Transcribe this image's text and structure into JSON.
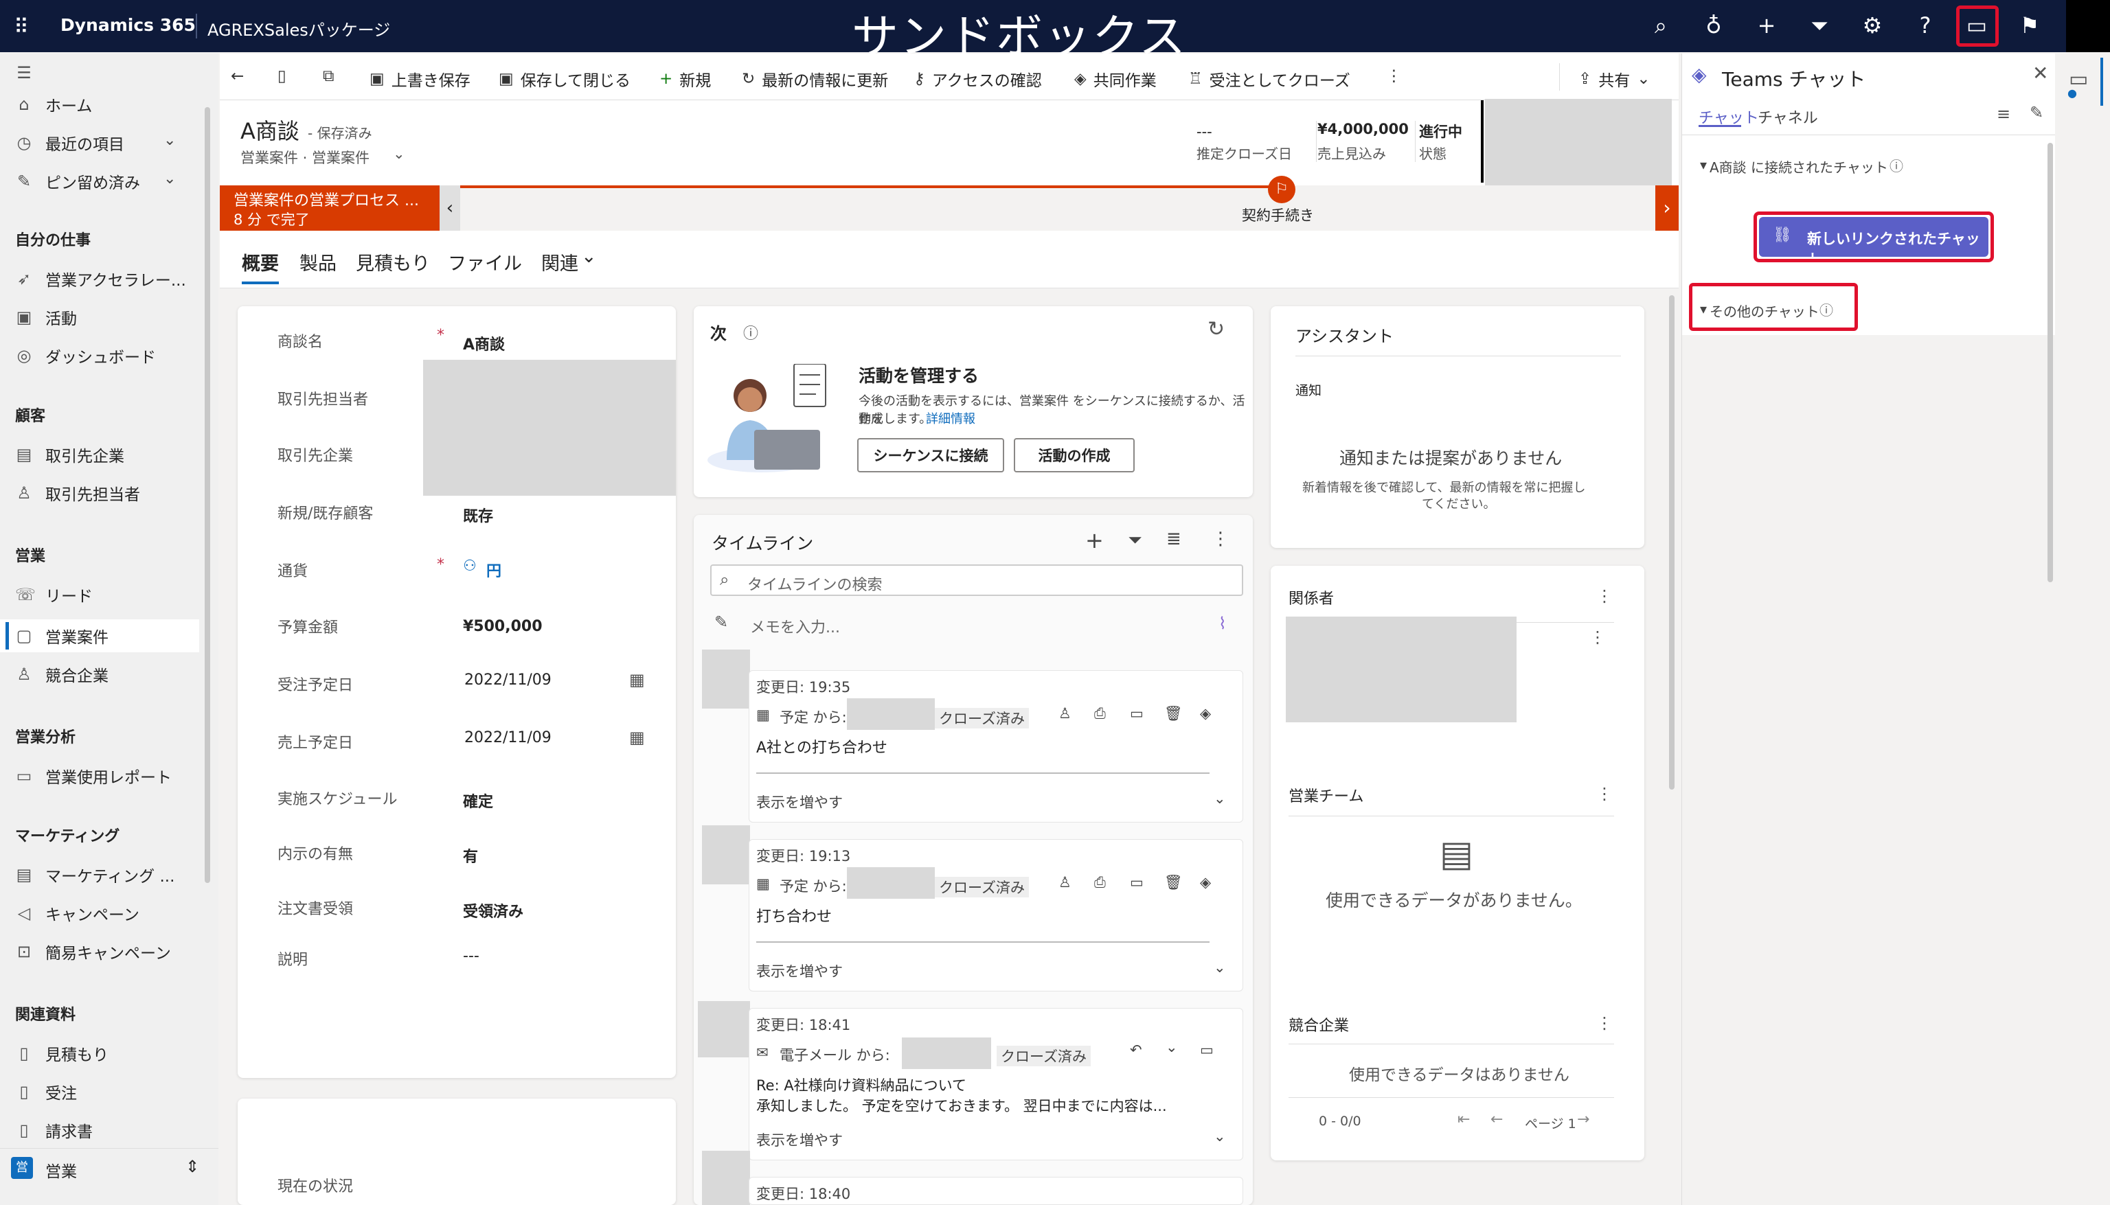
{
  "topbar": {
    "app_name": "Dynamics 365",
    "package": "AGREXSalesパッケージ",
    "banner": "サンドボックス",
    "icons": [
      "search-icon",
      "lightbulb-icon",
      "plus-icon",
      "filter-icon",
      "settings-icon",
      "help-icon",
      "teams-chat-icon",
      "feedback-icon"
    ]
  },
  "nav": {
    "home": "ホーム",
    "recent": "最近の項目",
    "pinned": "ピン留め済み",
    "my_work": "自分の仕事",
    "accelerator": "営業アクセラレー...",
    "activities": "活動",
    "dashboard": "ダッシュボード",
    "customers": "顧客",
    "accounts": "取引先企業",
    "contacts": "取引先担当者",
    "sales": "営業",
    "leads": "リード",
    "opportunities": "営業案件",
    "competitors": "競合企業",
    "analytics": "営業分析",
    "usage_report": "営業使用レポート",
    "marketing": "マーケティング",
    "marketing_lists": "マーケティング ...",
    "campaigns": "キャンペーン",
    "quick_campaigns": "簡易キャンペーン",
    "collateral": "関連資料",
    "quotes": "見積もり",
    "orders": "受注",
    "invoices": "請求書",
    "area_badge": "営",
    "area_label": "営業"
  },
  "cmdbar": {
    "save": "上書き保存",
    "save_close": "保存して閉じる",
    "new": "新規",
    "refresh": "最新の情報に更新",
    "access": "アクセスの確認",
    "collab": "共同作業",
    "close_won": "受注としてクローズ",
    "share": "共有"
  },
  "header": {
    "title": "A商談",
    "saved": "- 保存済み",
    "entity": "営業案件 · 営業案件",
    "close_date_value": "---",
    "close_date_label": "推定クローズ日",
    "revenue_value": "¥4,000,000",
    "revenue_label": "売上見込み",
    "status_value": "進行中",
    "status_label": "状態"
  },
  "bpf": {
    "process_name": "営業案件の営業プロセス ...",
    "duration": "8 分 で完了",
    "stage": "契約手続き"
  },
  "tabs": [
    "概要",
    "製品",
    "見積もり",
    "ファイル",
    "関連"
  ],
  "fields": [
    {
      "label": "商談名",
      "value": "A商談",
      "required": true
    },
    {
      "label": "取引先担当者",
      "value": ""
    },
    {
      "label": "取引先企業",
      "value": ""
    },
    {
      "label": "新規/既存顧客",
      "value": "既存"
    },
    {
      "label": "通貨",
      "value": "円",
      "required": true
    },
    {
      "label": "予算金額",
      "value": "¥500,000"
    },
    {
      "label": "受注予定日",
      "value": "2022/11/09"
    },
    {
      "label": "売上予定日",
      "value": "2022/11/09"
    },
    {
      "label": "実施スケジュール",
      "value": "確定"
    },
    {
      "label": "内示の有無",
      "value": "有"
    },
    {
      "label": "注文書受領",
      "value": "受領済み"
    },
    {
      "label": "説明",
      "value": "---"
    }
  ],
  "current_status": "現在の状況",
  "next": {
    "title": "次",
    "heading": "活動を管理する",
    "desc1": "今後の活動を表示するには、営業案件 をシーケンスに接続するか、活動を",
    "desc2": "作成します。",
    "link": "詳細情報",
    "btn_connect": "シーケンスに接続",
    "btn_create": "活動の作成"
  },
  "timeline": {
    "title": "タイムライン",
    "search_placeholder": "タイムラインの検索",
    "note_placeholder": "メモを入力...",
    "items": [
      {
        "modified": "変更日: 19:35",
        "from": "予定 から:",
        "status": "クローズ済み",
        "subject": "A社との打ち合わせ",
        "more": "表示を増やす"
      },
      {
        "modified": "変更日: 19:13",
        "from": "予定 から:",
        "status": "クローズ済み",
        "subject": "打ち合わせ",
        "more": "表示を増やす"
      },
      {
        "modified": "変更日: 18:41",
        "from": "電子メール から:",
        "status": "クローズ済み",
        "subject": "Re: A社様向け資料納品について",
        "body": "承知しました。 予定を空けておきます。 翌日中までに内容は...",
        "more": "表示を増やす"
      },
      {
        "modified": "変更日: 18:40"
      }
    ]
  },
  "assistant": {
    "title": "アシスタント",
    "sub": "通知",
    "empty": "通知または提案がありません",
    "desc1": "新着情報を後で確認して、最新の情報を常に把握し",
    "desc2": "てください。"
  },
  "stakeholders": {
    "title": "関係者"
  },
  "sales_team": {
    "title": "営業チーム",
    "empty": "使用できるデータがありません。"
  },
  "competitors_card": {
    "title": "競合企業",
    "empty": "使用できるデータはありません",
    "count": "0 - 0/0",
    "page": "ページ 1"
  },
  "teams": {
    "title": "Teams チャット",
    "tab_chat": "チャット",
    "tab_channel": "チャネル",
    "connected": "A商談 に接続されたチャット",
    "new_linked": "新しいリンクされたチャット",
    "other": "その他のチャット"
  },
  "colors": {
    "topbar": "#0e1a3a",
    "accent": "#5b5fc7",
    "bpf_active": "#d83b01",
    "highlight": "#e0102d",
    "link": "#0f6cbd"
  }
}
